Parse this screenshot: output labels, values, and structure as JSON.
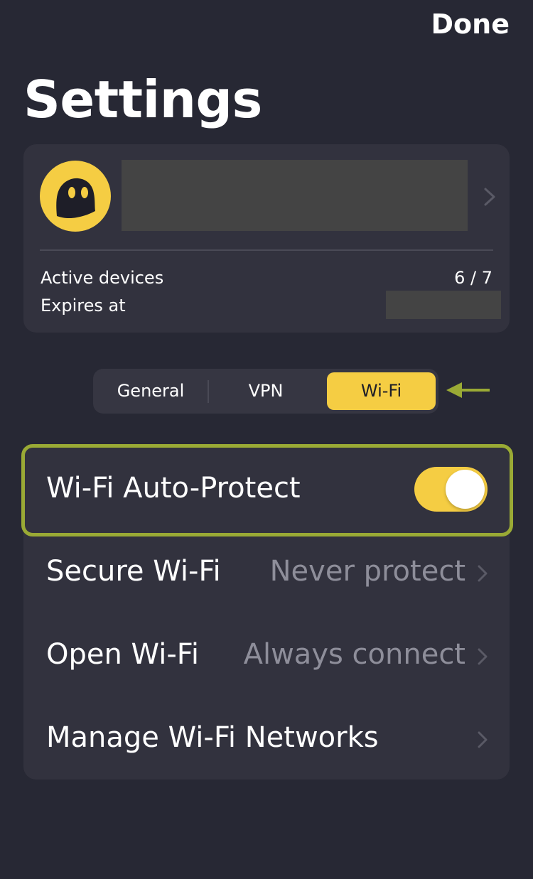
{
  "header": {
    "done_label": "Done",
    "title": "Settings"
  },
  "account": {
    "avatar_icon": "cyberghost-ghost-icon",
    "active_devices_label": "Active devices",
    "active_devices_value": "6 / 7",
    "expires_label": "Expires at"
  },
  "tabs": {
    "items": [
      {
        "label": "General"
      },
      {
        "label": "VPN"
      },
      {
        "label": "Wi-Fi"
      }
    ],
    "selected": "Wi-Fi"
  },
  "wifi_settings": {
    "auto_protect_label": "Wi-Fi Auto-Protect",
    "auto_protect_on": true,
    "secure_wifi_label": "Secure Wi-Fi",
    "secure_wifi_value": "Never protect",
    "open_wifi_label": "Open Wi-Fi",
    "open_wifi_value": "Always connect",
    "manage_networks_label": "Manage Wi-Fi Networks"
  },
  "colors": {
    "background": "#272834",
    "card": "#32323e",
    "accent": "#f5cd43",
    "highlight": "#9aaa35",
    "secondary_text": "#8e8e9a"
  }
}
